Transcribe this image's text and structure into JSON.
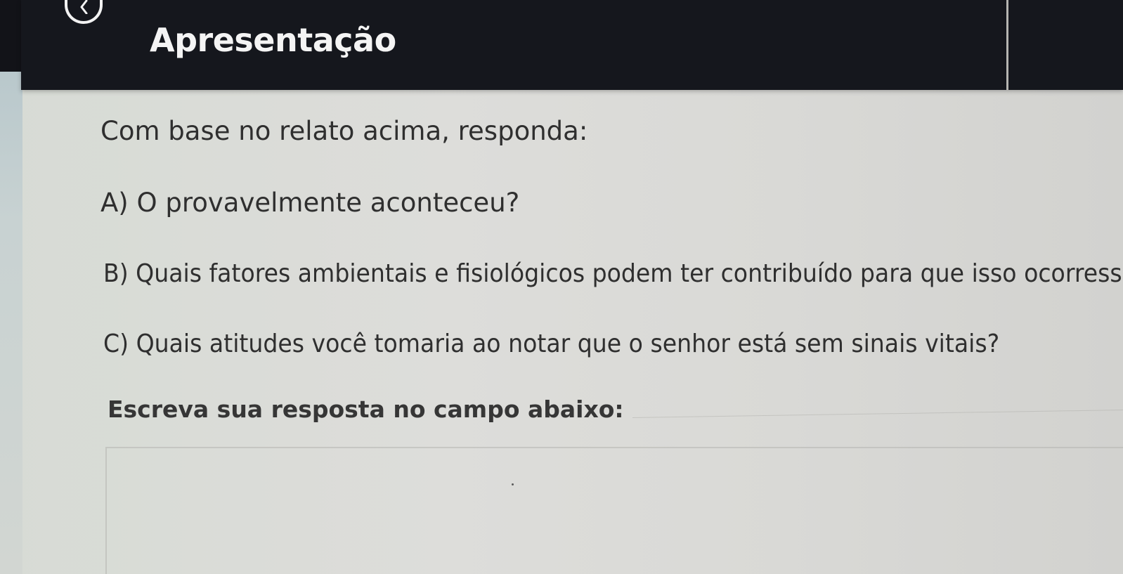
{
  "header": {
    "title": "Apresentação",
    "back_icon": "chevron-left-icon"
  },
  "content": {
    "intro": "Com base no relato acima, responda:",
    "questions": [
      "A) O provavelmente aconteceu?",
      "B) Quais fatores ambientais e fisiológicos podem ter contribuído para que isso ocorress",
      "C) Quais atitudes você tomaria ao notar que o senhor está sem sinais vitais?"
    ],
    "answer_label": "Escreva sua resposta no campo abaixo:",
    "answer_value": ""
  },
  "colors": {
    "header_background": "#15171d",
    "text": "#2f2f2f",
    "page_background": "#dcdcd6"
  }
}
